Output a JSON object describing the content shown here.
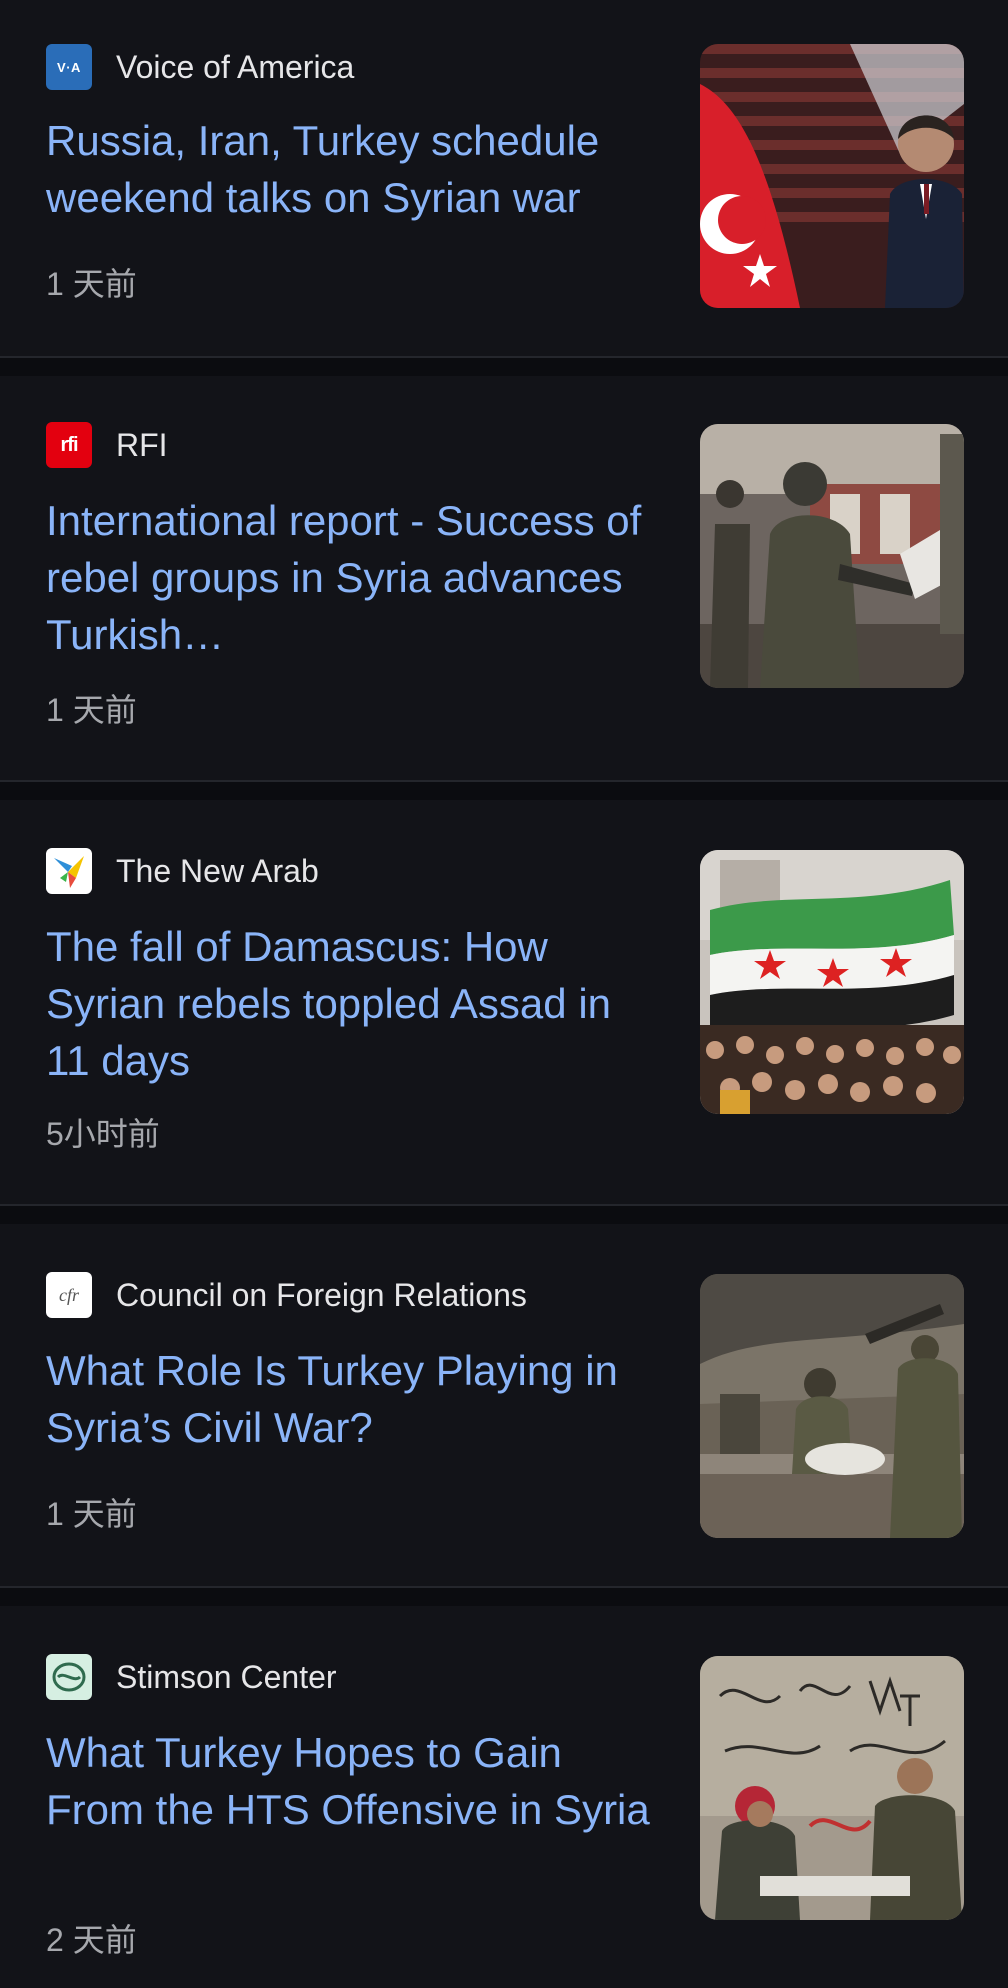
{
  "articles": [
    {
      "source": "Voice of America",
      "logo_text": "V·A",
      "headline": "Russia, Iran, Turkey schedule weekend talks on Syrian war",
      "time": "1 天前"
    },
    {
      "source": "RFI",
      "logo_text": "rfi",
      "headline": "International report - Success of rebel groups in Syria advances Turkish…",
      "time": "1 天前"
    },
    {
      "source": "The New Arab",
      "logo_text": "",
      "headline": "The fall of Damascus: How Syrian rebels toppled Assad in 11 days",
      "time": "5小时前"
    },
    {
      "source": "Council on Foreign Relations",
      "logo_text": "cfr",
      "headline": "What Role Is Turkey Playing in Syria’s Civil War?",
      "time": "1 天前"
    },
    {
      "source": "Stimson Center",
      "logo_text": "",
      "headline": "What Turkey Hopes to Gain From the HTS Offensive in Syria",
      "time": "2 天前"
    }
  ],
  "colors": {
    "headline": "#8ab4f8",
    "source": "#e6e6e8",
    "time": "#a6a8ad",
    "card_bg": "#121318",
    "separator": "#0b0c10"
  }
}
